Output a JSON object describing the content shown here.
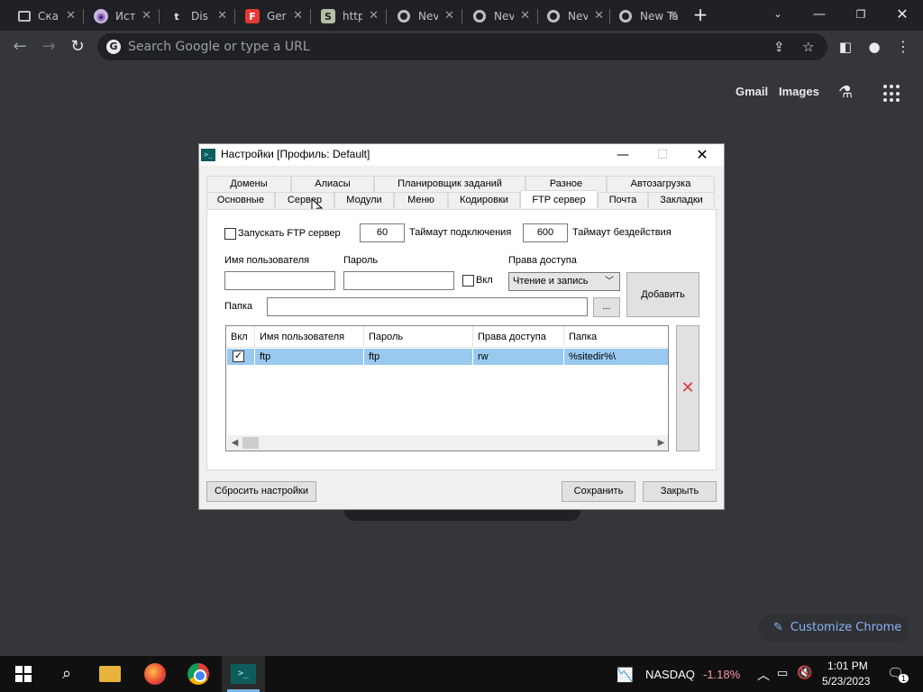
{
  "browser": {
    "tabs": [
      {
        "title": "Ска",
        "icon": "page-icon"
      },
      {
        "title": "Ист",
        "icon": "podcast-icon"
      },
      {
        "title": "Dis",
        "icon": "tumblr-icon"
      },
      {
        "title": "Ger",
        "icon": "f-icon"
      },
      {
        "title": "http",
        "icon": "s-icon"
      },
      {
        "title": "Nev",
        "icon": "chrome-icon"
      },
      {
        "title": "Nev",
        "icon": "chrome-icon"
      },
      {
        "title": "Nev",
        "icon": "chrome-icon"
      },
      {
        "title": "New Tal",
        "icon": "chrome-icon"
      }
    ],
    "omnibox_placeholder": "Search Google or type a URL",
    "ntp": {
      "gmail": "Gmail",
      "images": "Images",
      "customize": "Customize Chrome"
    }
  },
  "dialog": {
    "title": "Настройки [Профиль: Default]",
    "tabs_row1": [
      "Домены",
      "Алиасы",
      "Планировщик заданий",
      "Разное",
      "Автозагрузка"
    ],
    "tabs_row2": [
      "Основные",
      "Сервер",
      "Модули",
      "Меню",
      "Кодировки",
      "FTP сервер",
      "Почта",
      "Закладки"
    ],
    "active_tab": "FTP сервер",
    "ftp": {
      "start_label": "Запускать FTP сервер",
      "start_checked": false,
      "conn_timeout_value": "60",
      "conn_timeout_label": "Таймаут подключения",
      "idle_timeout_value": "600",
      "idle_timeout_label": "Таймаут бездействия",
      "username_label": "Имя пользователя",
      "password_label": "Пароль",
      "enabled_label": "Вкл",
      "rights_label": "Права доступа",
      "rights_value": "Чтение и запись",
      "add_button": "Добавить",
      "folder_label": "Папка",
      "browse_button": "..."
    },
    "grid": {
      "columns": [
        "Вкл",
        "Имя пользователя",
        "Пароль",
        "Права доступа",
        "Папка"
      ],
      "rows": [
        {
          "enabled": true,
          "username": "ftp",
          "password": "ftp",
          "rights": "rw",
          "folder": "%sitedir%\\"
        }
      ]
    },
    "buttons": {
      "reset": "Сбросить настройки",
      "save": "Сохранить",
      "close": "Закрыть"
    }
  },
  "taskbar": {
    "stock_name": "NASDAQ",
    "stock_change": "-1.18%",
    "time": "1:01 PM",
    "date": "5/23/2023",
    "notifications": "1"
  },
  "colors": {
    "chrome_bg": "#35363a",
    "selection": "#99c9ef",
    "stock_negative": "#ff99a4",
    "link_blue": "#8ab4f8"
  }
}
